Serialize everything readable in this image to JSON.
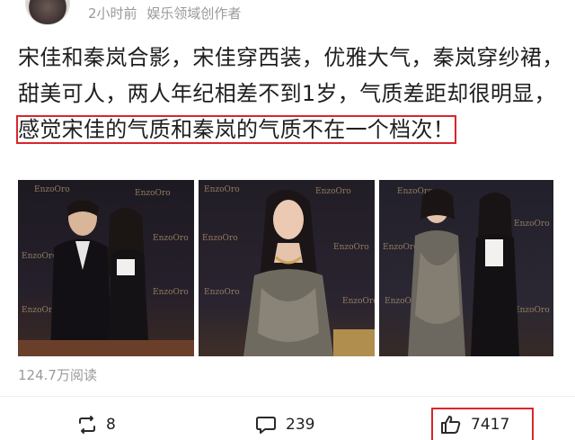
{
  "header": {
    "time": "2小时前",
    "author_tag": "娱乐领域创作者"
  },
  "post": {
    "text_main": "宋佳和秦岚合影，宋佳穿西装，优雅大气，秦岚穿纱裙，甜美可人，两人年纪相差不到1岁，气质差距却很明显，",
    "text_highlight": "感觉宋佳的气质和秦岚的气质不在一个档次！"
  },
  "photos": {
    "watermark": "EnzoOro"
  },
  "stats": {
    "reads": "124.7万阅读"
  },
  "actions": {
    "repost_count": "8",
    "comment_count": "239",
    "like_count": "7417"
  },
  "colors": {
    "highlight_border": "#d9262c",
    "meta_text": "#9a9a9a"
  }
}
